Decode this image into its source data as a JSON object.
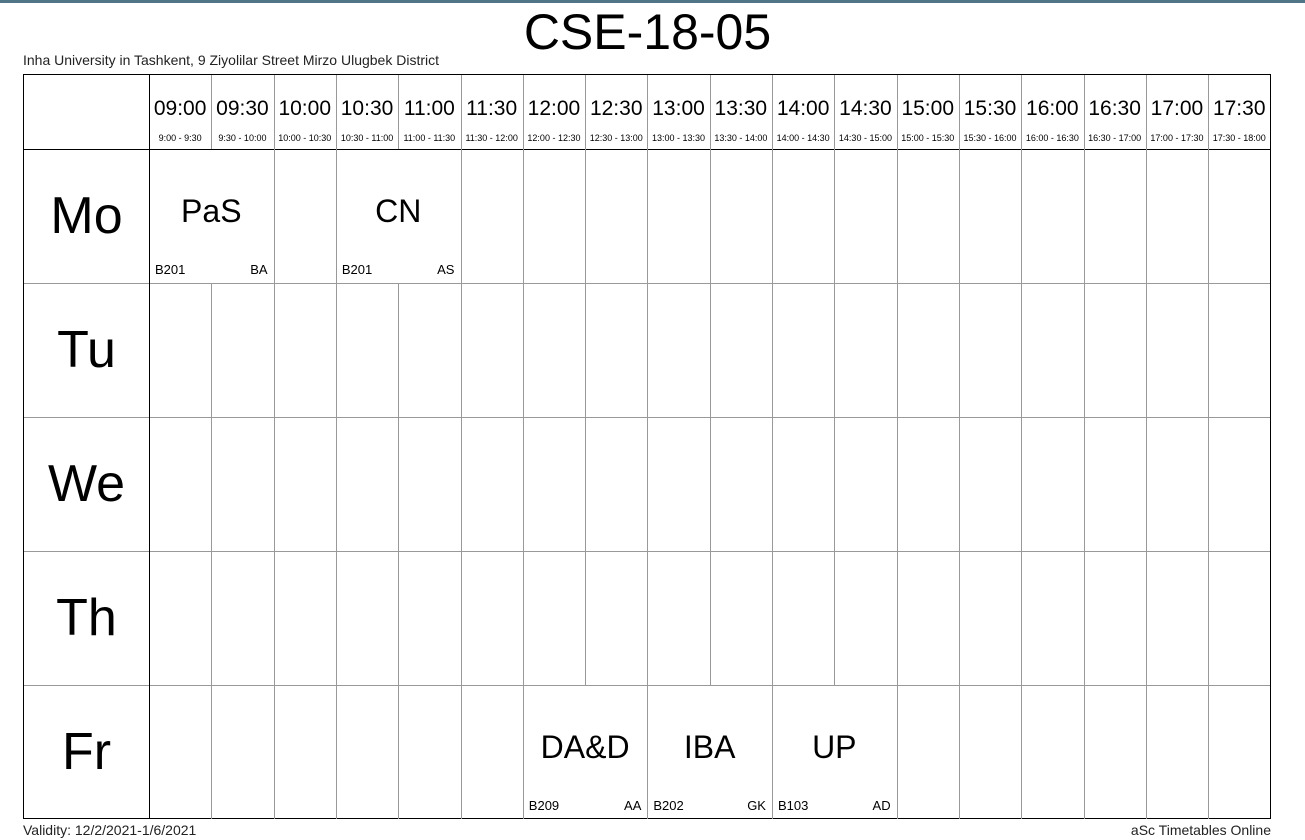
{
  "header": {
    "title": "CSE-18-05",
    "subtitle": "Inha University in Tashkent, 9 Ziyolilar Street Mirzo Ulugbek District"
  },
  "footer": {
    "validity": "Validity: 12/2/2021-1/6/2021",
    "brand": "aSc Timetables Online"
  },
  "periods": [
    {
      "time": "09:00",
      "range": "9:00 - 9:30"
    },
    {
      "time": "09:30",
      "range": "9:30 - 10:00"
    },
    {
      "time": "10:00",
      "range": "10:00 - 10:30"
    },
    {
      "time": "10:30",
      "range": "10:30 - 11:00"
    },
    {
      "time": "11:00",
      "range": "11:00 - 11:30"
    },
    {
      "time": "11:30",
      "range": "11:30 - 12:00"
    },
    {
      "time": "12:00",
      "range": "12:00 - 12:30"
    },
    {
      "time": "12:30",
      "range": "12:30 - 13:00"
    },
    {
      "time": "13:00",
      "range": "13:00 - 13:30"
    },
    {
      "time": "13:30",
      "range": "13:30 - 14:00"
    },
    {
      "time": "14:00",
      "range": "14:00 - 14:30"
    },
    {
      "time": "14:30",
      "range": "14:30 - 15:00"
    },
    {
      "time": "15:00",
      "range": "15:00 - 15:30"
    },
    {
      "time": "15:30",
      "range": "15:30 - 16:00"
    },
    {
      "time": "16:00",
      "range": "16:00 - 16:30"
    },
    {
      "time": "16:30",
      "range": "16:30 - 17:00"
    },
    {
      "time": "17:00",
      "range": "17:00 - 17:30"
    },
    {
      "time": "17:30",
      "range": "17:30 - 18:00"
    }
  ],
  "days": [
    "Mo",
    "Tu",
    "We",
    "Th",
    "Fr"
  ],
  "lessons": [
    {
      "day": "Mo",
      "start": "09:00",
      "end": "10:00",
      "subject": "PaS",
      "room": "B201",
      "teacher": "BA"
    },
    {
      "day": "Mo",
      "start": "10:30",
      "end": "11:30",
      "subject": "CN",
      "room": "B201",
      "teacher": "AS"
    },
    {
      "day": "Fr",
      "start": "12:00",
      "end": "13:00",
      "subject": "DA&D",
      "room": "B209",
      "teacher": "AA"
    },
    {
      "day": "Fr",
      "start": "13:00",
      "end": "14:00",
      "subject": "IBA",
      "room": "B202",
      "teacher": "GK"
    },
    {
      "day": "Fr",
      "start": "14:00",
      "end": "15:00",
      "subject": "UP",
      "room": "B103",
      "teacher": "AD"
    }
  ]
}
